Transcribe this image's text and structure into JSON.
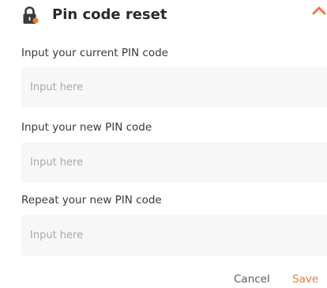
{
  "panel": {
    "title": "Pin code reset",
    "lock_icon": "lock-icon",
    "collapse_icon": "chevron-up-icon",
    "accent_color": "#f07a3a"
  },
  "fields": [
    {
      "label": "Input your current PIN code",
      "placeholder": "Input here",
      "value": ""
    },
    {
      "label": "Input your new PIN code",
      "placeholder": "Input here",
      "value": ""
    },
    {
      "label": "Repeat your new PIN code",
      "placeholder": "Input here",
      "value": ""
    }
  ],
  "actions": {
    "cancel_label": "Cancel",
    "save_label": "Save"
  }
}
